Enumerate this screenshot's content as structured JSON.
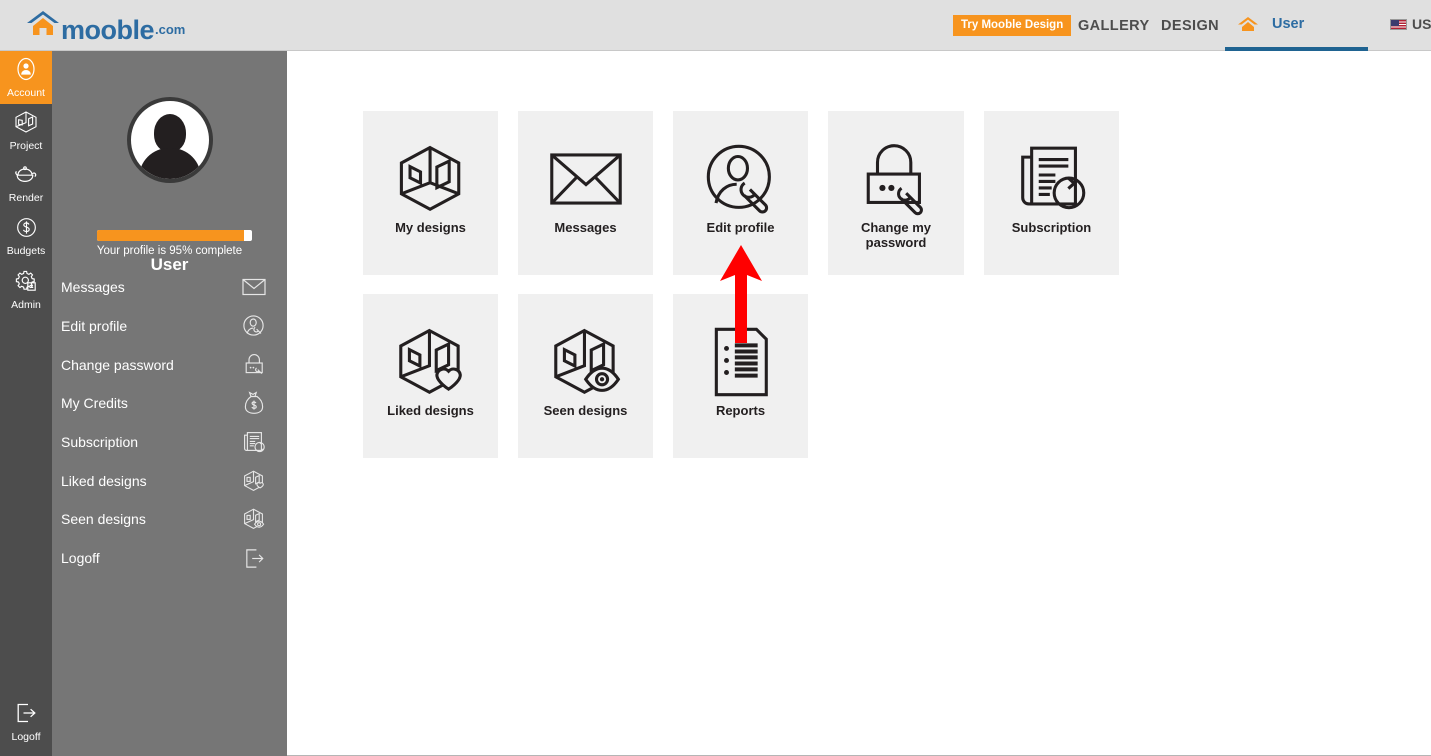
{
  "header": {
    "brand_name": "mooble",
    "brand_tld": ".com",
    "cta_label": "Try Mooble Design",
    "nav": [
      {
        "label": "GALLERY"
      },
      {
        "label": "DESIGN"
      }
    ],
    "user_tab_label": "User",
    "locale_label": "US",
    "accent_orange": "#f7941e",
    "brand_blue": "#2d6ca2",
    "active_tab_underline": "#1f6391"
  },
  "rail": {
    "items": [
      {
        "label": "Account",
        "icon": "account-icon",
        "active": true
      },
      {
        "label": "Project",
        "icon": "project-cube-icon",
        "active": false
      },
      {
        "label": "Render",
        "icon": "render-teapot-icon",
        "active": false
      },
      {
        "label": "Budgets",
        "icon": "dollar-circle-icon",
        "active": false
      },
      {
        "label": "Admin",
        "icon": "gear-admin-icon",
        "active": false
      }
    ],
    "logoff": {
      "label": "Logoff",
      "icon": "logoff-icon"
    }
  },
  "sidebar": {
    "profile_name": "User",
    "progress_percent": 95,
    "progress_caption": "Your profile is 95% complete",
    "avatar_alt": "avatar",
    "menu": [
      {
        "label": "Messages",
        "icon": "envelope-icon"
      },
      {
        "label": "Edit profile",
        "icon": "profile-wrench-icon"
      },
      {
        "label": "Change password",
        "icon": "lock-wrench-icon"
      },
      {
        "label": "My Credits",
        "icon": "money-bag-icon"
      },
      {
        "label": "Subscription",
        "icon": "document-refresh-icon"
      },
      {
        "label": "Liked designs",
        "icon": "cube-heart-icon"
      },
      {
        "label": "Seen designs",
        "icon": "cube-eye-icon"
      },
      {
        "label": "Logoff",
        "icon": "logoff-icon"
      }
    ]
  },
  "main": {
    "tiles_row1": [
      {
        "label": "My designs",
        "icon": "cube-icon"
      },
      {
        "label": "Messages",
        "icon": "envelope-icon"
      },
      {
        "label": "Edit profile",
        "icon": "profile-wrench-icon"
      },
      {
        "label": "Change my password",
        "icon": "lock-wrench-icon"
      },
      {
        "label": "Subscription",
        "icon": "document-refresh-icon"
      }
    ],
    "tiles_row2": [
      {
        "label": "Liked designs",
        "icon": "cube-heart-icon"
      },
      {
        "label": "Seen designs",
        "icon": "cube-eye-icon"
      },
      {
        "label": "Reports",
        "icon": "report-list-icon"
      }
    ]
  },
  "annotation": {
    "arrow_color": "#ff0000",
    "arrow_points_to": "Edit profile"
  }
}
